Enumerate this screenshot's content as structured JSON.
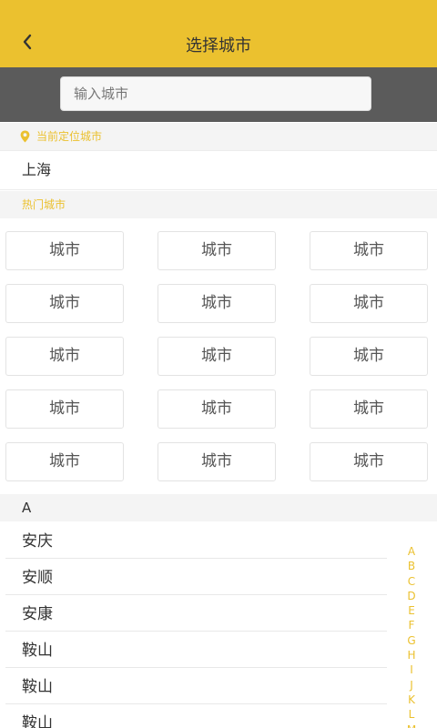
{
  "header": {
    "title": "选择城市",
    "back_icon": "chevron-left-icon"
  },
  "search": {
    "placeholder": "输入城市",
    "value": ""
  },
  "location": {
    "label": "当前定位城市",
    "icon": "location-pin-icon",
    "city": "上海"
  },
  "hot": {
    "label": "热门城市",
    "cities": [
      "城市",
      "城市",
      "城市",
      "城市",
      "城市",
      "城市",
      "城市",
      "城市",
      "城市",
      "城市",
      "城市",
      "城市",
      "城市",
      "城市",
      "城市"
    ]
  },
  "list": {
    "letter": "A",
    "items": [
      "安庆",
      "安顺",
      "安康",
      "鞍山",
      "鞍山",
      "鞍山"
    ]
  },
  "index": {
    "letters": [
      "A",
      "B",
      "C",
      "D",
      "E",
      "F",
      "G",
      "H",
      "I",
      "J",
      "K",
      "L",
      "M"
    ]
  },
  "colors": {
    "accent": "#ebc12f",
    "search_bar_bg": "#5b5b5b",
    "section_bg": "#f4f4f4"
  }
}
